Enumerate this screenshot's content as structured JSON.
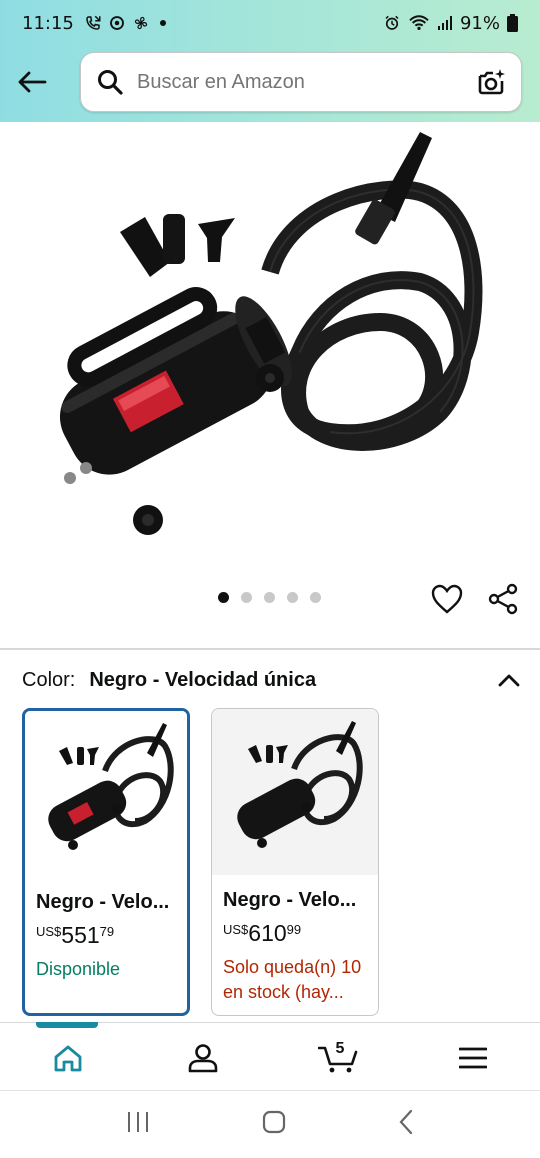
{
  "status_bar": {
    "time": "11:15",
    "battery": "91%"
  },
  "search": {
    "placeholder": "Buscar en Amazon"
  },
  "product": {
    "image_dots": 5,
    "active_dot": 0
  },
  "color_selector": {
    "label": "Color:",
    "value": "Negro - Velocidad única"
  },
  "variants": [
    {
      "name": "Negro - Velo...",
      "currency": "US$",
      "whole": "551",
      "fraction": "79",
      "availability": "Disponible",
      "status": "in-stock"
    },
    {
      "name": "Negro - Velo...",
      "currency": "US$",
      "whole": "610",
      "fraction": "99",
      "availability": "Solo queda(n) 10 en stock (hay...",
      "status": "low-stock"
    }
  ],
  "bottom_nav": {
    "cart_count": "5"
  },
  "colors": {
    "accent_selected": "#2162a1",
    "available_green": "#067d62",
    "low_stock_red": "#b12704",
    "nav_indicator": "#1a8aa0"
  }
}
